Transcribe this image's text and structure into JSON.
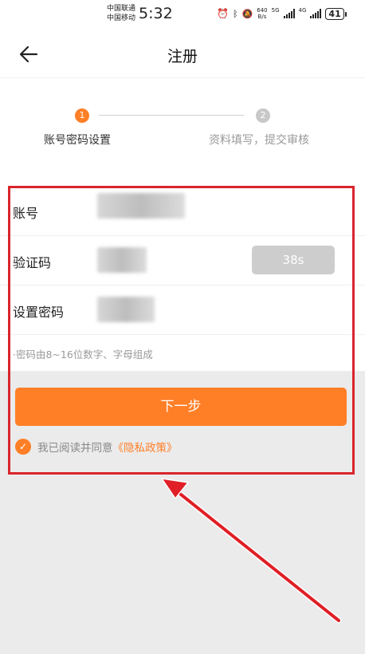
{
  "status_bar": {
    "carrier_1": "中国联通",
    "carrier_2": "中国移动",
    "time": "5:32",
    "speed_value": "640",
    "speed_unit": "B/s",
    "network_1": "5G",
    "network_2": "4G",
    "battery": "41"
  },
  "header": {
    "title": "注册",
    "back_icon": "arrow-left-icon"
  },
  "steps": [
    {
      "number": "1",
      "label": "账号密码设置",
      "active": true
    },
    {
      "number": "2",
      "label": "资料填写，提交审核",
      "active": false
    }
  ],
  "form": {
    "account_label": "账号",
    "code_label": "验证码",
    "code_button": "38s",
    "password_label": "设置密码",
    "password_hint": "·密码由8~16位数字、字母组成"
  },
  "next_button": "下一步",
  "agreement": {
    "text": "我已阅读并同意",
    "link": "《隐私政策》",
    "checked": true
  },
  "colors": {
    "accent": "#ff7f27",
    "highlight": "#d9252c",
    "disabled": "#cdcdcd"
  }
}
